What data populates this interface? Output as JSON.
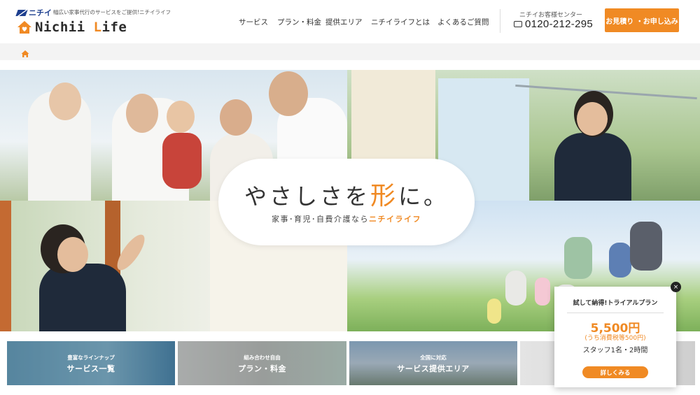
{
  "header": {
    "brand_small": "ニチイ",
    "tagline": "幅広い家事代行のサービスをご提供!ニチイライフ",
    "brand_main_a": "Nichii ",
    "brand_main_b": "L",
    "brand_main_c": "ife",
    "nav": [
      {
        "label": "サービス"
      },
      {
        "label": "プラン・料金"
      },
      {
        "label": "提供エリア"
      },
      {
        "label": "ニチイライフとは"
      },
      {
        "label": "よくあるご質問"
      }
    ],
    "tel_label": "ニチイお客様センター",
    "tel_number": "0120-212-295",
    "cta_label": "お見積り ・お申し込み"
  },
  "hero": {
    "title_a": "やさしさを",
    "title_accent": "形",
    "title_b": "に。",
    "sub_a": "家事･育児･自費介護なら",
    "sub_accent": "ニチイライフ"
  },
  "cards": [
    {
      "small": "豊富なラインナップ",
      "big": "サービス一覧"
    },
    {
      "small": "組み合わせ自由",
      "big": "プラン・料金"
    },
    {
      "small": "全国に対応",
      "big": "サービス提供エリア"
    },
    {
      "small": "",
      "big": ""
    }
  ],
  "popup": {
    "title": "試して納得!トライアルプラン",
    "price": "5,500円",
    "tax": "(うち消費税等500円)",
    "staff": "スタッフ1名・2時間",
    "button": "詳しくみる",
    "close": "×"
  },
  "colors": {
    "accent": "#f08a24",
    "brand_blue": "#1d3f8f"
  }
}
